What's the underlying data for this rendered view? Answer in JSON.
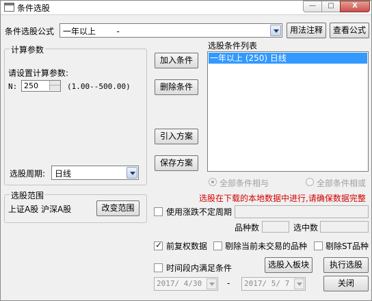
{
  "window": {
    "title": "条件选股",
    "min_label": "—",
    "max_label": "□",
    "close_label": "X"
  },
  "formula": {
    "label": "条件选股公式",
    "value": "一年以上        -",
    "usage_button": "用法注释",
    "view_button": "查看公式"
  },
  "params": {
    "group_title": "计算参数",
    "prompt": "请设置计算参数:",
    "n_label": "N:",
    "n_value": "250",
    "n_range": "(1.00--500.00)",
    "period_label": "选股周期:",
    "period_value": "日线"
  },
  "actions": {
    "add": "加入条件",
    "delete": "删除条件",
    "import": "引入方案",
    "save": "保存方案"
  },
  "conditions": {
    "title": "选股条件列表",
    "items": [
      "一年以上 (250) 日线"
    ],
    "and_label": "全部条件相与",
    "or_label": "全部条件相或"
  },
  "scope": {
    "group_title": "选股范围",
    "value": "上证A股 沪深A股",
    "change_button": "改变范围"
  },
  "status": {
    "message": "选股在下载的本地数据中进行,请确保数据完整",
    "message_color": "#d40000"
  },
  "options": {
    "use_change_period": "使用涨跌不定周期",
    "variety_count_label": "品种数",
    "selected_count_label": "选中数",
    "adjusted_data": "前复权数据",
    "exclude_untraded": "剔除当前未交易的品种",
    "exclude_st": "剔除ST品种",
    "time_range": "时间段内满足条件",
    "date_separator": "-"
  },
  "dates": {
    "start": "2017/ 4/30",
    "end": "2017/ 5/ 7"
  },
  "bottom": {
    "to_block": "选股入板块",
    "execute": "执行选股",
    "close": "关闭"
  }
}
